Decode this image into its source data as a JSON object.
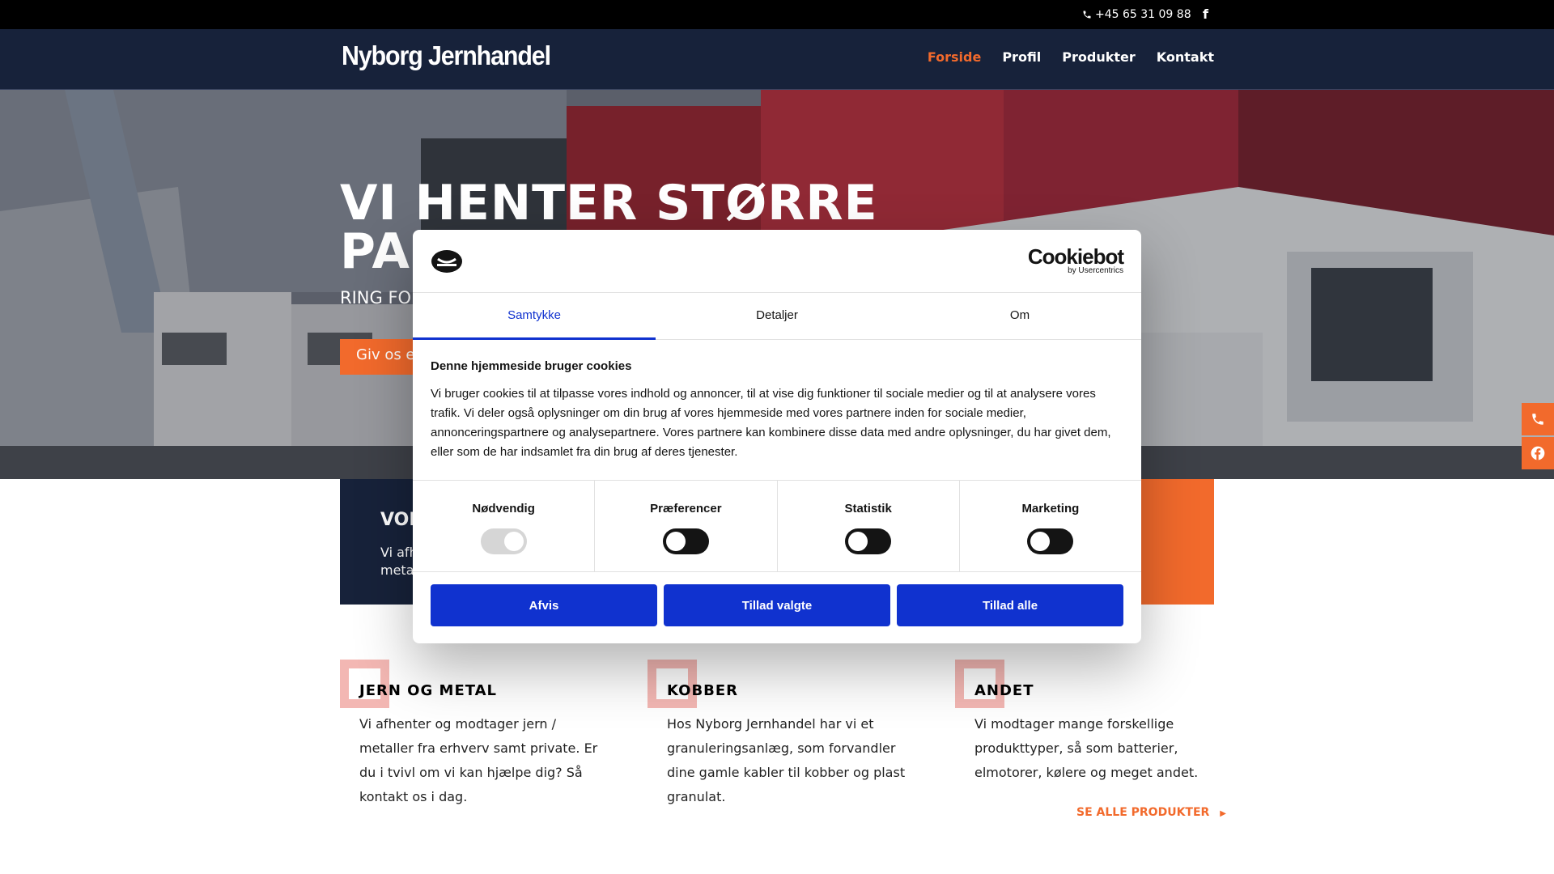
{
  "topbar": {
    "phone": "+45 65 31 09 88",
    "facebook_icon": "facebook-icon"
  },
  "header": {
    "logo": "Nyborg Jernhandel",
    "nav": [
      "Forside",
      "Profil",
      "Produkter",
      "Kontakt"
    ],
    "active": "Forside"
  },
  "hero": {
    "title": "VI HENTER STØRRE PA",
    "subtitle": "RING FO",
    "button": "Giv os et",
    "side_buttons": [
      "phone-icon",
      "facebook-icon"
    ]
  },
  "info_block": {
    "title": "VOR",
    "text_line1": "Vi afh",
    "text_line2": "meta"
  },
  "features": [
    {
      "title": "JERN OG METAL",
      "text": "Vi afhenter og modtager jern / metaller fra erhverv samt private. Er du i tvivl om vi kan hjælpe dig? Så kontakt os i dag."
    },
    {
      "title": "KOBBER",
      "text": "Hos Nyborg Jernhandel har vi et granuleringsanlæg, som forvandler dine gamle kabler til kobber og plast granulat."
    },
    {
      "title": "ANDET",
      "text": "Vi modtager mange forskellige produkttyper, så som batterier, elmotorer, kølere og meget andet."
    }
  ],
  "see_all": "SE ALLE PRODUKTER",
  "cookie": {
    "brand": "Cookiebot",
    "brand_sub": "by Usercentrics",
    "tabs": [
      "Samtykke",
      "Detaljer",
      "Om"
    ],
    "active_tab": "Samtykke",
    "heading": "Denne hjemmeside bruger cookies",
    "body": "Vi bruger cookies til at tilpasse vores indhold og annoncer, til at vise dig funktioner til sociale medier og til at analysere vores trafik. Vi deler også oplysninger om din brug af vores hjemmeside med vores partnere inden for sociale medier, annonceringspartnere og analysepartnere. Vores partnere kan kombinere disse data med andre oplysninger, du har givet dem, eller som de har indsamlet fra din brug af deres tjenester.",
    "categories": [
      {
        "label": "Nødvendig",
        "checked": true,
        "disabled": true
      },
      {
        "label": "Præferencer",
        "checked": false,
        "disabled": false
      },
      {
        "label": "Statistik",
        "checked": false,
        "disabled": false
      },
      {
        "label": "Marketing",
        "checked": false,
        "disabled": false
      }
    ],
    "buttons": [
      "Afvis",
      "Tillad valgte",
      "Tillad alle"
    ]
  },
  "colors": {
    "accent": "#f26a2c",
    "navy": "#17223a",
    "cookie_blue": "#1032cf"
  }
}
